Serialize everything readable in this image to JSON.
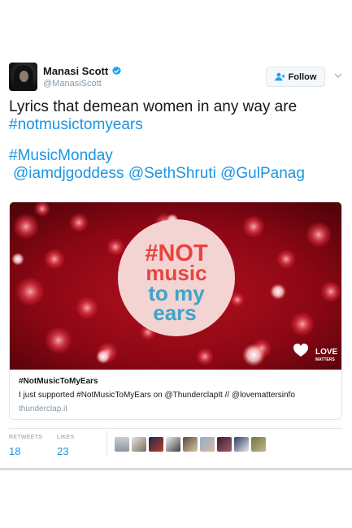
{
  "user": {
    "display_name": "Manasi Scott",
    "handle": "@ManasiScott"
  },
  "follow_button": {
    "label": "Follow"
  },
  "tweet": {
    "line1": "Lyrics that demean women in any way are",
    "line2_hashtag": "#notmusictomyears",
    "line3_hashtag": "#MusicMonday",
    "mentions": [
      "@iamdjgoddess",
      "@SethShruti",
      "@GulPanag"
    ]
  },
  "card": {
    "image": {
      "logo_lines": [
        "#NOT",
        "music",
        "to my",
        "ears"
      ],
      "brand": [
        "LOVE",
        "MATTERS"
      ]
    },
    "title": "#NotMusicToMyEars",
    "description": "I just supported #NotMusicToMyEars on @ThunderclapIt // @lovemattersinfo",
    "domain": "thunderclap.it"
  },
  "stats": {
    "retweets_label": "RETWEETS",
    "retweets": "18",
    "likes_label": "LIKES",
    "likes": "23"
  },
  "colors": {
    "link": "#1b95e0",
    "muted": "#8899a6",
    "logo": "#e8443f",
    "logo_blue": "#3ea3c9"
  },
  "icons": [
    "verified-badge-icon",
    "follow-person-icon",
    "chevron-down-icon",
    "love-matters-heart-icon"
  ]
}
